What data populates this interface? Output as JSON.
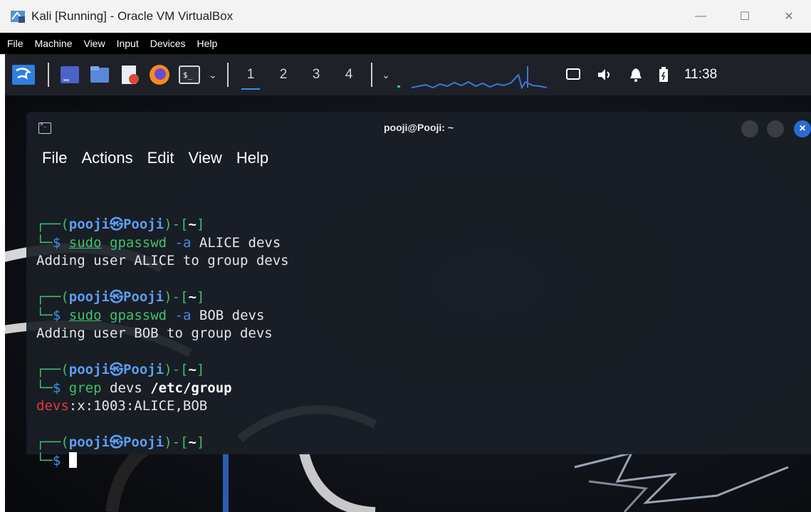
{
  "host": {
    "title": "Kali [Running] - Oracle VM VirtualBox",
    "controls": {
      "minimize": "—",
      "maximize": "☐",
      "close": "✕"
    }
  },
  "vbox_menu": [
    "File",
    "Machine",
    "View",
    "Input",
    "Devices",
    "Help"
  ],
  "panel": {
    "workspaces": [
      "1",
      "2",
      "3",
      "4"
    ],
    "active_workspace": "1",
    "clock": "11:38",
    "icons": [
      "kali-menu-icon",
      "desktop-icon",
      "file-manager-icon",
      "text-editor-icon",
      "firefox-icon",
      "terminal-icon",
      "network-monitor-icon",
      "display-icon",
      "volume-icon",
      "notification-icon",
      "battery-icon"
    ]
  },
  "terminal": {
    "title": "pooji@Pooji: ~",
    "menu": [
      "File",
      "Actions",
      "Edit",
      "View",
      "Help"
    ],
    "prompt": {
      "user": "pooji",
      "host": "Pooji",
      "dir": "~",
      "symbol": "$"
    },
    "blocks": [
      {
        "cmd_kw": "sudo",
        "cmd_bin": "gpasswd",
        "cmd_opt": "-a",
        "cmd_rest": "ALICE devs",
        "output": "Adding user ALICE to group devs"
      },
      {
        "cmd_kw": "sudo",
        "cmd_bin": "gpasswd",
        "cmd_opt": "-a",
        "cmd_rest": "BOB devs",
        "output": "Adding user BOB to group devs"
      },
      {
        "cmd_bin": "grep",
        "cmd_arg": "devs",
        "cmd_path": "/etc/group",
        "output_match": "devs",
        "output_rest": ":x:1003:ALICE,BOB"
      }
    ]
  },
  "colors": {
    "prompt_blue": "#3f8fe9",
    "prompt_green": "#3ec16d",
    "match_red": "#e23a3a",
    "panel_bg": "#1e2128",
    "terminal_bg": "#1a1e26"
  }
}
